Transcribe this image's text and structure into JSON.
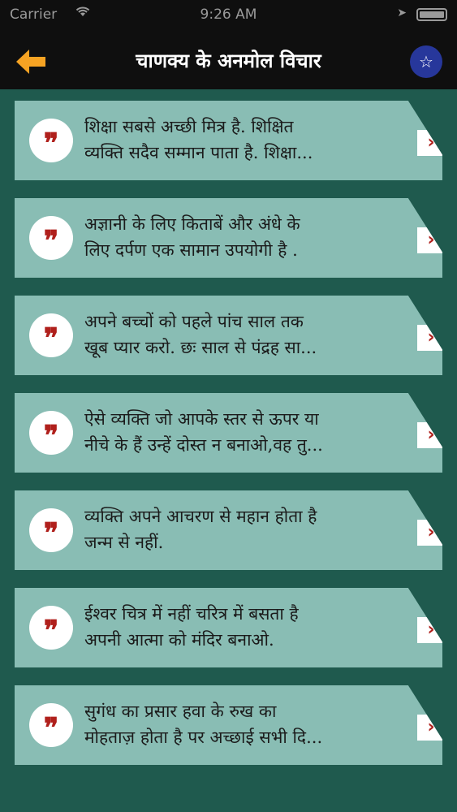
{
  "status": {
    "carrier": "Carrier",
    "time": "9:26 AM"
  },
  "header": {
    "title": "चाणक्य के अनमोल विचार"
  },
  "icons": {
    "back": "back-arrow-icon",
    "favorite": "star-icon",
    "quote": "quote-icon",
    "chevron": "chevron-right-icon"
  },
  "colors": {
    "background": "#1f5a4e",
    "card": "#89bdb4",
    "accent": "#f6a323",
    "quote_mark": "#b0201c",
    "favorite_button": "#27379b"
  },
  "quotes": [
    {
      "line1": "शिक्षा सबसे अच्छी मित्र है. शिक्षित",
      "line2": "व्यक्ति सदैव सम्मान पाता है. शिक्षा..."
    },
    {
      "line1": "अज्ञानी के लिए किताबें और अंधे के",
      "line2": "लिए दर्पण एक सामान उपयोगी है ."
    },
    {
      "line1": "अपने बच्चों को पहले पांच साल तक",
      "line2": "खूब प्यार करो. छः साल से पंद्रह सा..."
    },
    {
      "line1": "ऐसे व्यक्ति जो आपके स्तर से ऊपर या",
      "line2": "नीचे के हैं उन्हें दोस्त न बनाओ,वह तु..."
    },
    {
      "line1": "व्यक्ति अपने आचरण से महान होता है",
      "line2": "जन्म से नहीं."
    },
    {
      "line1": "ईश्वर चित्र में नहीं चरित्र में बसता है",
      "line2": "अपनी आत्मा को मंदिर बनाओ."
    },
    {
      "line1": "सुगंध का प्रसार हवा के रुख का",
      "line2": "मोहताज़ होता है पर अच्छाई सभी दि..."
    }
  ]
}
